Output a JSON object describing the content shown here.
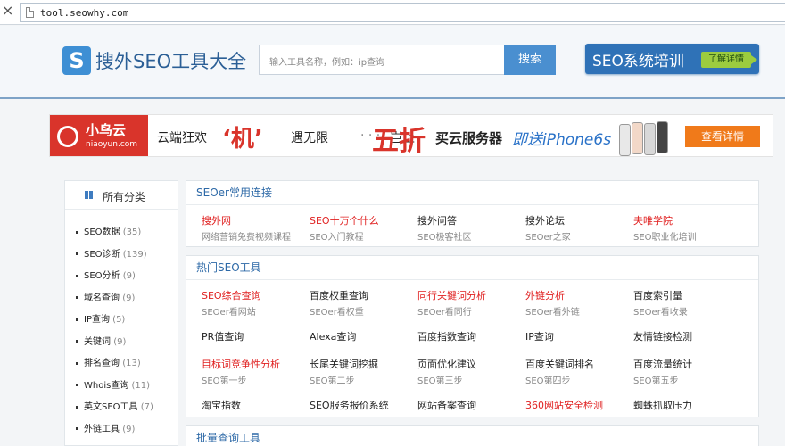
{
  "browser": {
    "close_glyph": "×",
    "url": "tool.seowhy.com"
  },
  "header": {
    "logo_letter": "S",
    "logo_text": "搜外SEO工具大全",
    "search_placeholder": "输入工具名称，例如：ip查询",
    "search_button": "搜索",
    "training_label": "SEO系统培训",
    "training_more": "了解详情"
  },
  "banner": {
    "brand": "小鸟云",
    "brand_sub": "niaoyun.com",
    "slogan1": "云端狂欢",
    "highlight1": "‘机’",
    "slogan2": "遇无限",
    "dots": "· · ·",
    "slogan3": "岂止",
    "highlight2": "五折",
    "slogan4": "买云服务器",
    "phone": "即送iPhone6s",
    "cta": "查看详情",
    "brand_color": "#d9342b"
  },
  "sidebar": {
    "title": "所有分类",
    "items": [
      {
        "label": "SEO数据",
        "count": "(35)"
      },
      {
        "label": "SEO诊断",
        "count": "(139)"
      },
      {
        "label": "SEO分析",
        "count": "(9)"
      },
      {
        "label": "域名查询",
        "count": "(9)"
      },
      {
        "label": "IP查询",
        "count": "(5)"
      },
      {
        "label": "关键词",
        "count": "(9)"
      },
      {
        "label": "排名查询",
        "count": "(13)"
      },
      {
        "label": "Whois查询",
        "count": "(11)"
      },
      {
        "label": "英文SEO工具",
        "count": "(7)"
      },
      {
        "label": "外链工具",
        "count": "(9)"
      }
    ]
  },
  "panels": {
    "common": {
      "title": "SEOer常用连接",
      "items": [
        {
          "name": "搜外网",
          "desc": "网络营销免费视频课程",
          "red": true
        },
        {
          "name": "SEO十万个什么",
          "desc": "SEO入门教程",
          "red": true
        },
        {
          "name": "搜外问答",
          "desc": "SEO极客社区",
          "red": false
        },
        {
          "name": "搜外论坛",
          "desc": "SEOer之家",
          "red": false
        },
        {
          "name": "夫唯学院",
          "desc": "SEO职业化培训",
          "red": true
        }
      ]
    },
    "hot": {
      "title": "热门SEO工具",
      "items": [
        {
          "name": "SEO综合查询",
          "desc": "SEOer看网站",
          "red": true
        },
        {
          "name": "百度权重查询",
          "desc": "SEOer看权重",
          "red": false
        },
        {
          "name": "同行关键词分析",
          "desc": "SEOer看同行",
          "red": true
        },
        {
          "name": "外链分析",
          "desc": "SEOer看外链",
          "red": true
        },
        {
          "name": "百度索引量",
          "desc": "SEOer看收录",
          "red": false
        },
        {
          "name": "PR值查询",
          "desc": "",
          "red": false
        },
        {
          "name": "Alexa查询",
          "desc": "",
          "red": false
        },
        {
          "name": "百度指数查询",
          "desc": "",
          "red": false
        },
        {
          "name": "IP查询",
          "desc": "",
          "red": false
        },
        {
          "name": "友情链接检测",
          "desc": "",
          "red": false
        },
        {
          "name": "目标词竞争性分析",
          "desc": "SEO第一步",
          "red": true
        },
        {
          "name": "长尾关键词挖掘",
          "desc": "SEO第二步",
          "red": false
        },
        {
          "name": "页面优化建议",
          "desc": "SEO第三步",
          "red": false
        },
        {
          "name": "百度关键词排名",
          "desc": "SEO第四步",
          "red": false
        },
        {
          "name": "百度流量统计",
          "desc": "SEO第五步",
          "red": false
        },
        {
          "name": "淘宝指数",
          "desc": "",
          "red": false
        },
        {
          "name": "SEO服务报价系统",
          "desc": "",
          "red": false
        },
        {
          "name": "网站备案查询",
          "desc": "",
          "red": false
        },
        {
          "name": "360网站安全检测",
          "desc": "",
          "red": true
        },
        {
          "name": "蜘蛛抓取压力",
          "desc": "",
          "red": false
        }
      ]
    },
    "batch": {
      "title": "批量查询工具"
    }
  }
}
